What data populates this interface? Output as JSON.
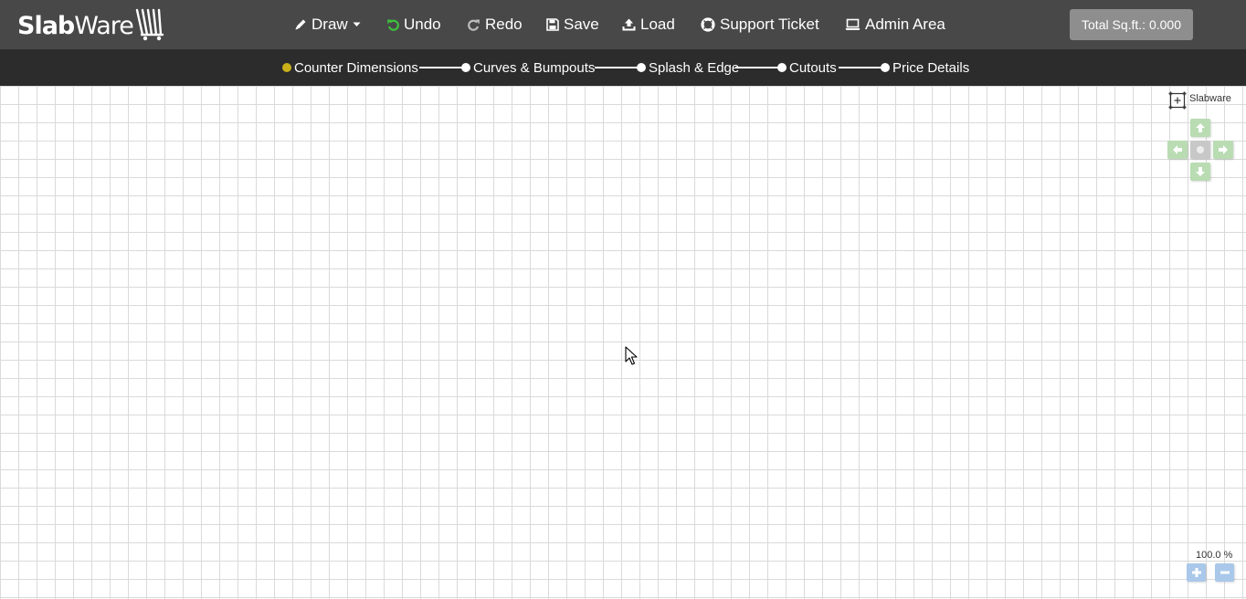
{
  "brand": {
    "bold": "Slab",
    "light": "Ware"
  },
  "toolbar": {
    "draw": "Draw",
    "undo": "Undo",
    "redo": "Redo",
    "save": "Save",
    "load": "Load",
    "support": "Support Ticket",
    "admin": "Admin Area"
  },
  "total_sqft": "Total Sq.ft.: 0.000",
  "steps": [
    {
      "label": "Counter Dimensions",
      "active": true
    },
    {
      "label": "Curves & Bumpouts",
      "active": false
    },
    {
      "label": "Splash & Edge",
      "active": false
    },
    {
      "label": "Cutouts",
      "active": false
    },
    {
      "label": "Price Details",
      "active": false
    }
  ],
  "canvas": {
    "brand_label": "Slabware",
    "zoom": "100.0 %"
  },
  "colors": {
    "topbar": "#484848",
    "stepsbar": "#2c2c2c",
    "active_step_dot": "#c9b11a",
    "undo_icon": "#3fbf3f",
    "pad_green": "#b9dcb3",
    "zoom_blue": "#a9c8ea"
  },
  "icons": {
    "draw": "pencil-icon",
    "undo": "undo-icon",
    "redo": "redo-icon",
    "save": "floppy-icon",
    "load": "upload-icon",
    "support": "lifebuoy-icon",
    "admin": "laptop-icon",
    "fit": "fit-to-screen-icon",
    "pan": [
      "arrow-up-icon",
      "arrow-left-icon",
      "center-icon",
      "arrow-right-icon",
      "arrow-down-icon"
    ],
    "zoom": [
      "plus-icon",
      "minus-icon"
    ]
  }
}
